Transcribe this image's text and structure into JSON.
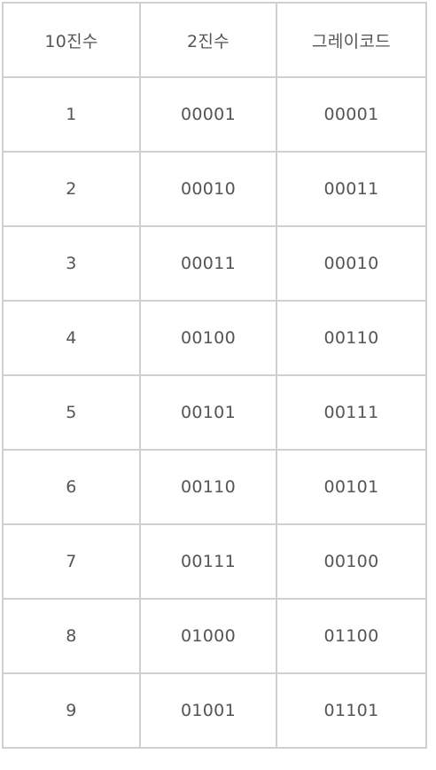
{
  "table": {
    "headers": [
      "10진수",
      "2진수",
      "그레이코드"
    ],
    "rows": [
      [
        "1",
        "00001",
        "00001"
      ],
      [
        "2",
        "00010",
        "00011"
      ],
      [
        "3",
        "00011",
        "00010"
      ],
      [
        "4",
        "00100",
        "00110"
      ],
      [
        "5",
        "00101",
        "00111"
      ],
      [
        "6",
        "00110",
        "00101"
      ],
      [
        "7",
        "00111",
        "00100"
      ],
      [
        "8",
        "01000",
        "01100"
      ],
      [
        "9",
        "01001",
        "01101"
      ]
    ]
  },
  "colors": {
    "border": "#cfcfcf",
    "text": "#555555",
    "background": "#ffffff"
  }
}
